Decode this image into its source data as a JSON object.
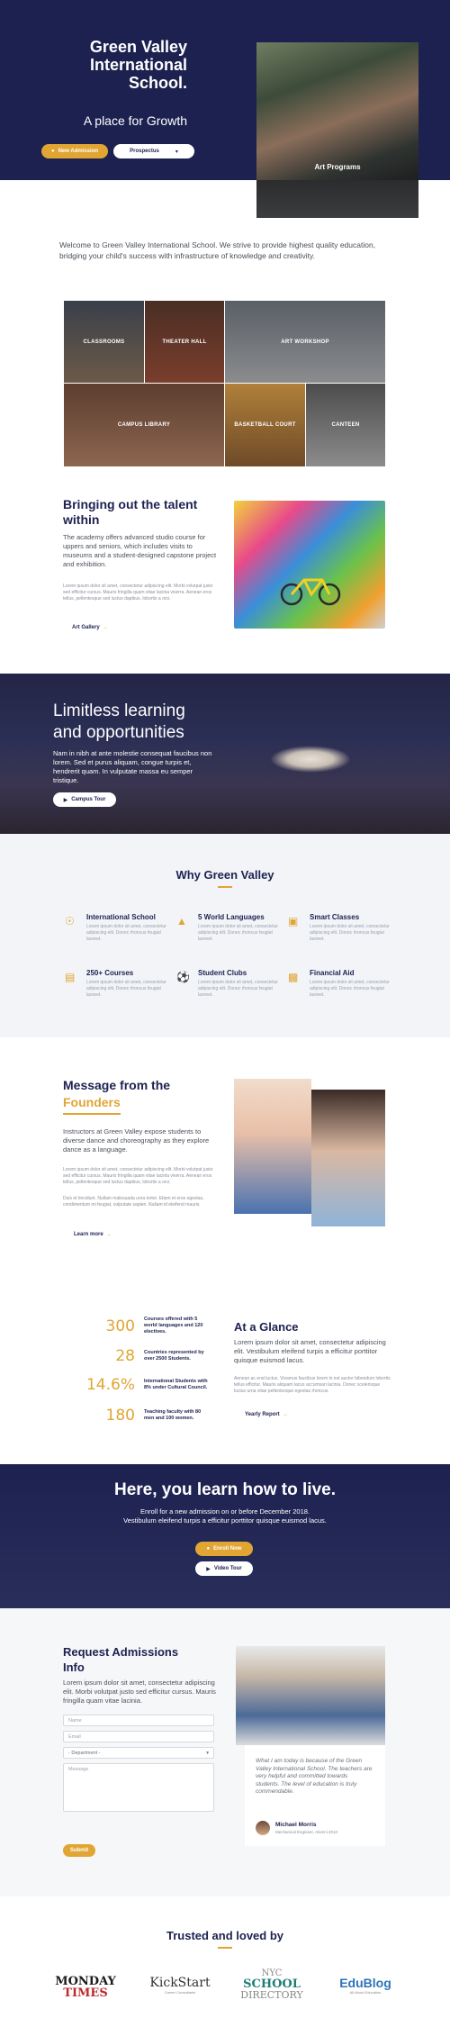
{
  "hero": {
    "title_line1": "Green Valley",
    "title_line2": "International",
    "title_line3": "School.",
    "tagline": "A place for Growth",
    "btn_admission": "New Admission",
    "btn_prospectus": "Prospectus",
    "image_caption": "Art Programs"
  },
  "welcome": {
    "text": "Welcome to Green Valley International School. We strive to provide highest quality education, bridging your child's success with infrastructure of knowledge and creativity."
  },
  "facilities": [
    {
      "label": "CLASSROOMS"
    },
    {
      "label": "THEATER HALL"
    },
    {
      "label": "ART WORKSHOP"
    },
    {
      "label": "CAMPUS LIBRARY"
    },
    {
      "label": "BASKETBALL COURT"
    },
    {
      "label": "CANTEEN"
    }
  ],
  "talent": {
    "title_line1": "Bringing out the talent",
    "title_line2": "within",
    "lead": "The academy offers advanced studio course for uppers and seniors, which includes visits to museums and a student-designed capstone project and exhibition.",
    "body": "Lorem ipsum dolor sit amet, consectetur adipiscing elit. Morbi volutpat justo sed efficitur cursus. Mauris fringilla quam vitae lacinia viverra. Aenean eros tellus, pellentesque sed luctus dapibus, lobortis a orci.",
    "link": "Art Gallery"
  },
  "limitless": {
    "title_line1": "Limitless learning",
    "title_line2": "and opportunities",
    "text": "Nam in nibh at ante molestie consequat faucibus non lorem. Sed et purus aliquam, congue turpis et, hendrerit quam. In vulputate massa eu semper tristique.",
    "btn": "Campus Tour"
  },
  "why": {
    "title": "Why Green Valley",
    "features": [
      {
        "title": "International School",
        "icon": "globe-icon",
        "text": "Lorem ipsum dolor sit amet, consectetur adipiscing elit. Donec rhoncus feugiat laoreet."
      },
      {
        "title": "5 World Languages",
        "icon": "graduation-cap-icon",
        "text": "Lorem ipsum dolor sit amet, consectetur adipiscing elit. Donec rhoncus feugiat laoreet."
      },
      {
        "title": "Smart Classes",
        "icon": "laptop-icon",
        "text": "Lorem ipsum dolor sit amet, consectetur adipiscing elit. Donec rhoncus feugiat laoreet."
      },
      {
        "title": "250+ Courses",
        "icon": "book-icon",
        "text": "Lorem ipsum dolor sit amet, consectetur adipiscing elit. Donec rhoncus feugiat laoreet."
      },
      {
        "title": "Student Clubs",
        "icon": "soccer-ball-icon",
        "text": "Lorem ipsum dolor sit amet, consectetur adipiscing elit. Donec rhoncus feugiat laoreet."
      },
      {
        "title": "Financial Aid",
        "icon": "money-icon",
        "text": "Lorem ipsum dolor sit amet, consectetur adipiscing elit. Donec rhoncus feugiat laoreet."
      }
    ]
  },
  "message": {
    "title_line1": "Message from the",
    "title_line2": "Founders",
    "lead": "Instructors at Green Valley expose students to diverse dance and choreography as they explore dance as a language.",
    "body1": "Lorem ipsum dolor sit amet, consectetur adipiscing elit. Morbi volutpat justo sed efficitur cursus. Mauris fringilla quam vitae lacinia viverra. Aenean eros tellus, pellentesque sed luctus dapibus, lobortis a orci.",
    "body2": "Duis et tincidunt. Nullam malesuada urna tortor. Etiam et eros egestas, condimentum mi feugiat, vulputate sapien. Nullam id eleifend mauris.",
    "link": "Learn more"
  },
  "stats": [
    {
      "num": "300",
      "label": "Courses offered with 5 world languages and 120 electives."
    },
    {
      "num": "28",
      "label": "Countries represented by over 2500 Students."
    },
    {
      "num": "14.6%",
      "label": "International Students with 8% under Cultural Council."
    },
    {
      "num": "180",
      "label": "Teaching faculty with 80 men and 100 women."
    }
  ],
  "glance": {
    "title": "At a Glance",
    "lead": "Lorem ipsum dolor sit amet, consectetur adipiscing elit. Vestibulum eleifend turpis a efficitur porttitor quisque euismod lacus.",
    "body": "Aenean ac erat luctus. Vivamus faucibus lorem in est auctor bibendum lobortis tellus efficitur. Mauris aliquam lacus accumsan lacinia. Donec scelerisque luctus urna vitae pellentesque egestas rhoncus.",
    "link": "Yearly Report"
  },
  "cta": {
    "title": "Here, you learn how to live.",
    "line1": "Enroll for a new admission on or before December 2018.",
    "line2": "Vestibulum eleifend turpis a efficitur porttitor quisque euismod lacus.",
    "btn_enroll": "Enroll Now",
    "btn_video": "Video Tour"
  },
  "admissions": {
    "title_line1": "Request Admissions",
    "title_line2": "Info",
    "lead": "Lorem ipsum dolor sit amet, consectetur adipiscing elit. Morbi volutpat justo sed efficitur cursus. Mauris fringilla quam vitae lacinia.",
    "name_placeholder": "Name",
    "email_placeholder": "Email",
    "department_value": "- Department -",
    "message_placeholder": "Message",
    "submit": "Submit",
    "quote": "What I am today is because of the Green Valley International School. The teachers are very helpful and committed towards students. The level of education is truly commendable.",
    "author": "Michael Morris",
    "author_role": "Mechanical Engineer, Alumni 2010"
  },
  "trusted": {
    "title": "Trusted and loved by",
    "logos": [
      {
        "line1": "MONDAY",
        "line2": "TIMES"
      },
      {
        "line1": "KickStart",
        "line2": "Career Consultants"
      },
      {
        "line1": "NYC",
        "line2": "SCHOOL",
        "line3": "DIRECTORY"
      },
      {
        "line1": "EduBlog",
        "line2": "All About Education"
      }
    ]
  },
  "colors": {
    "navy": "#1d2150",
    "gold": "#e1a533"
  }
}
